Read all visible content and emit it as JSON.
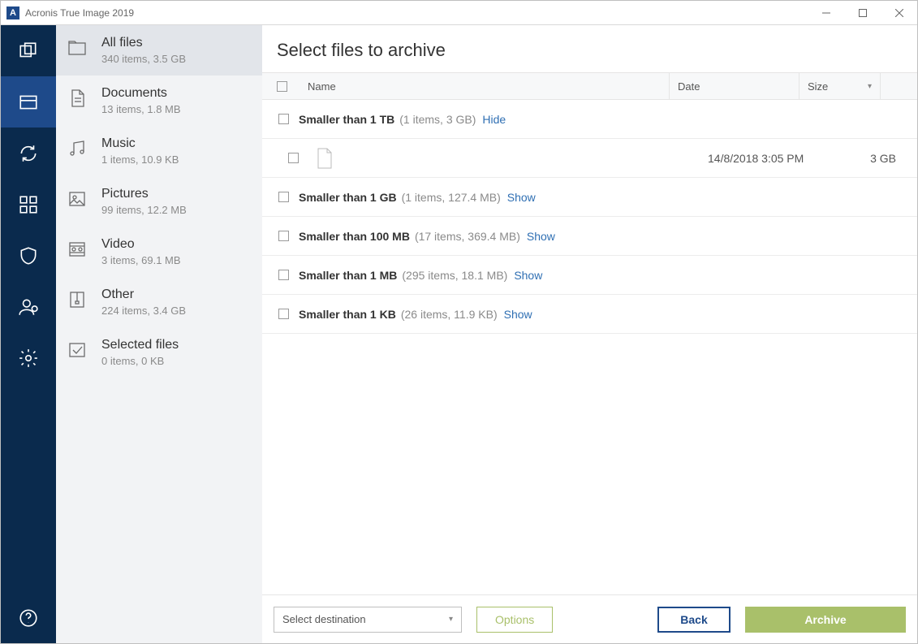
{
  "window": {
    "title": "Acronis True Image 2019",
    "logo_letter": "A"
  },
  "categories": [
    {
      "key": "all",
      "title": "All files",
      "sub": "340 items, 3.5 GB",
      "icon": "folder",
      "selected": true
    },
    {
      "key": "documents",
      "title": "Documents",
      "sub": "13 items, 1.8 MB",
      "icon": "document",
      "selected": false
    },
    {
      "key": "music",
      "title": "Music",
      "sub": "1 items, 10.9 KB",
      "icon": "music",
      "selected": false
    },
    {
      "key": "pictures",
      "title": "Pictures",
      "sub": "99 items, 12.2 MB",
      "icon": "picture",
      "selected": false
    },
    {
      "key": "video",
      "title": "Video",
      "sub": "3 items, 69.1 MB",
      "icon": "video",
      "selected": false
    },
    {
      "key": "other",
      "title": "Other",
      "sub": "224 items, 3.4 GB",
      "icon": "archive",
      "selected": false
    },
    {
      "key": "selected",
      "title": "Selected files",
      "sub": "0 items, 0 KB",
      "icon": "check",
      "selected": false
    }
  ],
  "main": {
    "heading": "Select files to archive",
    "columns": {
      "name": "Name",
      "date": "Date",
      "size": "Size"
    },
    "groups": [
      {
        "label": "Smaller than 1 TB",
        "meta": "(1 items, 3 GB)",
        "toggle": "Hide",
        "expanded": true,
        "rows": [
          {
            "name": "",
            "date": "14/8/2018 3:05 PM",
            "size": "3 GB"
          }
        ]
      },
      {
        "label": "Smaller than 1 GB",
        "meta": "(1 items, 127.4 MB)",
        "toggle": "Show",
        "expanded": false
      },
      {
        "label": "Smaller than 100 MB",
        "meta": "(17 items, 369.4 MB)",
        "toggle": "Show",
        "expanded": false
      },
      {
        "label": "Smaller than 1 MB",
        "meta": "(295 items, 18.1 MB)",
        "toggle": "Show",
        "expanded": false
      },
      {
        "label": "Smaller than 1 KB",
        "meta": "(26 items, 11.9 KB)",
        "toggle": "Show",
        "expanded": false
      }
    ]
  },
  "footer": {
    "destination_placeholder": "Select destination",
    "options": "Options",
    "back": "Back",
    "archive": "Archive"
  }
}
